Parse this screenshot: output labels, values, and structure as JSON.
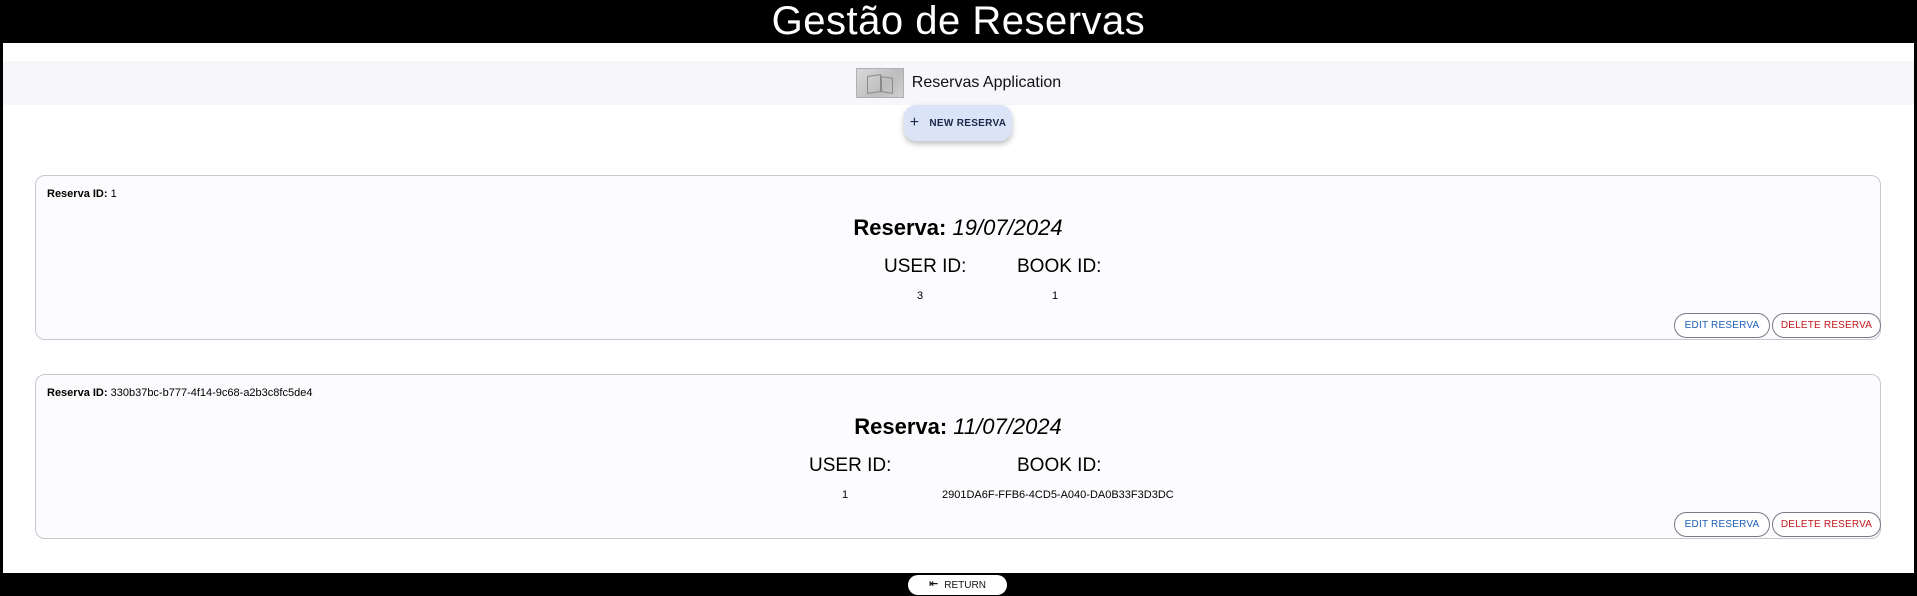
{
  "header": {
    "title": "Gestão de Reservas"
  },
  "appbar": {
    "logo_icon": "books-thumbnail-icon",
    "title": "Reservas Application"
  },
  "actions": {
    "new_label": "NEW RESERVA",
    "new_icon": "plus-icon"
  },
  "reservas": [
    {
      "id_label": "Reserva ID:",
      "id": "1",
      "date_label": "Reserva:",
      "date": "19/07/2024",
      "user_label": "USER ID:",
      "user_id": "3",
      "book_label": "BOOK ID:",
      "book_id": "1",
      "edit_label": "EDIT RESERVA",
      "delete_label": "DELETE RESERVA"
    },
    {
      "id_label": "Reserva ID:",
      "id": "330b37bc-b777-4f14-9c68-a2b3c8fc5de4",
      "date_label": "Reserva:",
      "date": "11/07/2024",
      "user_label": "USER ID:",
      "user_id": "1",
      "book_label": "BOOK ID:",
      "book_id": "2901DA6F-FFB6-4CD5-A040-DA0B33F3D3DC",
      "edit_label": "EDIT RESERVA",
      "delete_label": "DELETE RESERVA"
    }
  ],
  "footer": {
    "return_label": "RETURN",
    "return_icon": "first-page-icon"
  },
  "colors": {
    "edit": "#1d5db8",
    "delete": "#c0171b",
    "new_button_bg": "#dbe3f7"
  }
}
